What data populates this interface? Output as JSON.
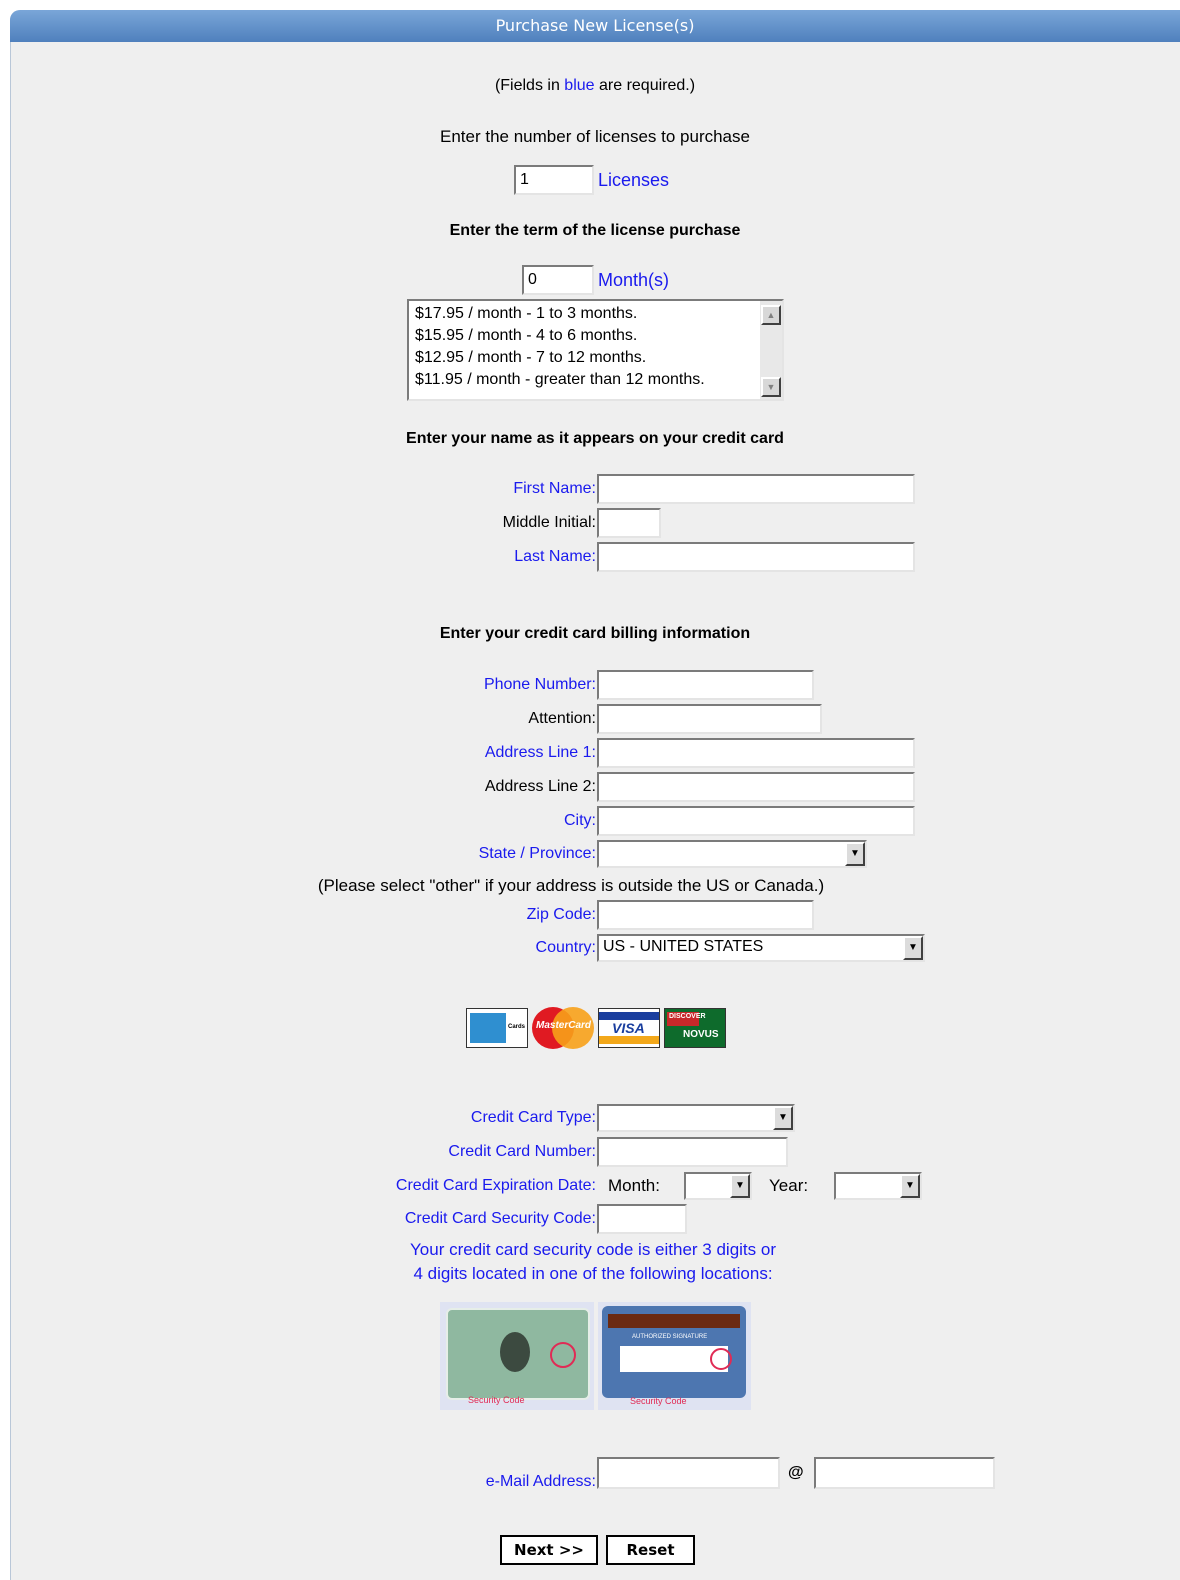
{
  "window": {
    "title": "Purchase New License(s)"
  },
  "intro": {
    "prefix": "(Fields in ",
    "blue_word": "blue",
    "suffix": " are required.)"
  },
  "licenses": {
    "prompt": "Enter the number of licenses to purchase",
    "value": "1",
    "unit": "Licenses"
  },
  "term": {
    "heading": "Enter the term of the license purchase",
    "value": "0",
    "unit": "Month(s)",
    "pricing_options": [
      "$17.95 / month - 1 to 3 months.",
      "$15.95 / month - 4 to 6 months.",
      "$12.95 / month - 7 to 12 months.",
      "$11.95 / month - greater than 12 months."
    ]
  },
  "name_section": {
    "heading": "Enter your name as it appears on your credit card",
    "first_name_label": "First Name:",
    "middle_initial_label": "Middle Initial:",
    "last_name_label": "Last Name:"
  },
  "billing": {
    "heading": "Enter your credit card billing information",
    "phone_label": "Phone Number:",
    "attention_label": "Attention:",
    "address1_label": "Address Line 1:",
    "address2_label": "Address Line 2:",
    "city_label": "City:",
    "state_label": "State / Province:",
    "state_note": "(Please select \"other\" if your address is outside the US or Canada.)",
    "zip_label": "Zip Code:",
    "country_label": "Country:",
    "country_value": "US - UNITED STATES"
  },
  "card_logos": [
    "american-express",
    "mastercard",
    "visa",
    "discover-novus"
  ],
  "card_logo_text": {
    "amex": "Cards",
    "mastercard": "MasterCard",
    "visa": "VISA",
    "discover_top": "DISCOVER",
    "discover_bottom": "NOVUS"
  },
  "card": {
    "type_label": "Credit Card Type:",
    "number_label": "Credit Card Number:",
    "expiration_label": "Credit Card Expiration Date:",
    "month_label": "Month:",
    "year_label": "Year:",
    "security_label": "Credit Card Security Code:",
    "security_note_line1": "Your credit card security code is either 3 digits or",
    "security_note_line2": "4 digits located in one of the following locations:",
    "security_caption": "Security Code",
    "signature_caption": "AUTHORIZED SIGNATURE"
  },
  "email": {
    "label": "e-Mail Address:",
    "at": "@"
  },
  "buttons": {
    "next": "Next >>",
    "reset": "Reset"
  },
  "colors": {
    "required": "#1a1aee",
    "titlebar": "#5b8bc7",
    "panel": "#efefef"
  }
}
